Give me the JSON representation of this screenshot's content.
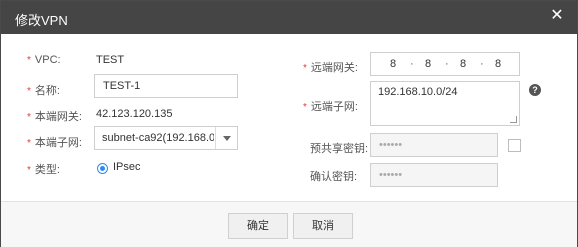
{
  "dialog": {
    "title": "修改VPN",
    "close_icon": "close-icon"
  },
  "left": {
    "vpc": {
      "label": "VPC:",
      "value": "TEST"
    },
    "name": {
      "label": "名称:",
      "value": "TEST-1"
    },
    "local_gateway": {
      "label": "本端网关:",
      "value": "42.123.120.135"
    },
    "local_subnet": {
      "label": "本端子网:",
      "value": "subnet-ca92(192.168.0. ..."
    },
    "type": {
      "label": "类型:",
      "option": "IPsec"
    }
  },
  "right": {
    "remote_gateway": {
      "label": "远端网关:",
      "octets": [
        "8",
        "8",
        "8",
        "8"
      ]
    },
    "remote_subnet": {
      "label": "远端子网:",
      "value": "192.168.10.0/24"
    },
    "psk": {
      "label": "预共享密钥:",
      "value": "••••••"
    },
    "confirm_psk": {
      "label": "确认密钥:",
      "value": "••••••"
    },
    "required_mark": "*",
    "help_icon_text": "?"
  },
  "footer": {
    "confirm_label": "确定",
    "cancel_label": "取消"
  }
}
